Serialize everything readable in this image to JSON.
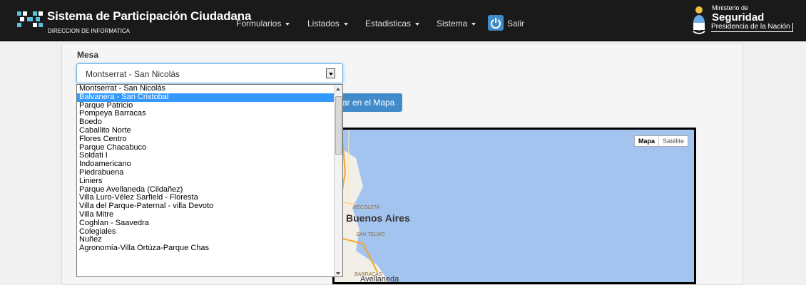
{
  "header": {
    "title": "Sistema de Participación Ciudadana",
    "subtitle": "DIRECCION DE INFORMATICA",
    "menu": [
      {
        "label": "Formularios"
      },
      {
        "label": "Listados"
      },
      {
        "label": "Estadisticas"
      },
      {
        "label": "Sistema"
      }
    ],
    "logout_label": "Salir",
    "ministry": {
      "line1": "Ministerio de",
      "line2": "Seguridad",
      "line3": "Presidencia de la Nación"
    }
  },
  "form": {
    "mesa_label": "Mesa",
    "selected_value": "Montserrat - San Nicolás",
    "map_button_label": "ar en el Mapa"
  },
  "map": {
    "type_map": "Mapa",
    "type_satellite": "Satélite",
    "city": "Buenos Aires",
    "labels": [
      "RECOLETA",
      "SAN TELMO",
      "BARRACAS",
      "Avellaneda"
    ]
  },
  "dropdown": {
    "highlighted_index": 1,
    "options": [
      "Montserrat - San Nicolás",
      "Balvanera - San Cristobal",
      "Parque Patricio",
      "Pompeya Barracas",
      "Boedo",
      "Caballito Norte",
      "Flores Centro",
      "Parque Chacabuco",
      "Soldati I",
      "Indoamericano",
      "Piedrabuena",
      "Liniers",
      "Parque Avellaneda (Cildañez)",
      "Villa Luro-Vélez Sarfield - Floresta",
      "Villa del Parque-Paternal - villa Devoto",
      "Villa Mitre",
      "Coghlan - Saavedra",
      "Colegiales",
      "Nuñez",
      "Agronomía-Villa Ortúza-Parque Chas"
    ]
  },
  "colors": {
    "navbar": "#1a1a1a",
    "accent": "#428bca",
    "highlight": "#3399ff"
  }
}
